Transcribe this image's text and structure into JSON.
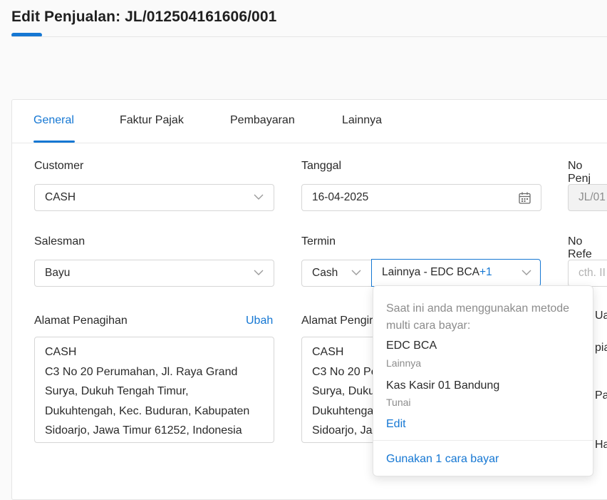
{
  "page": {
    "title": "Edit Penjualan: JL/012504161606/001"
  },
  "tabs": [
    {
      "label": "General",
      "active": true
    },
    {
      "label": "Faktur Pajak"
    },
    {
      "label": "Pembayaran"
    },
    {
      "label": "Lainnya"
    }
  ],
  "form": {
    "customer": {
      "label": "Customer",
      "value": "CASH"
    },
    "tanggal": {
      "label": "Tanggal",
      "value": "16-04-2025"
    },
    "no_penjualan": {
      "label": "No Penj",
      "value": "JL/01"
    },
    "salesman": {
      "label": "Salesman",
      "value": "Bayu"
    },
    "termin": {
      "label": "Termin",
      "value": "Cash"
    },
    "payment": {
      "value": "Lainnya - EDC BCA",
      "extra": "+1"
    },
    "no_referensi": {
      "label": "No Refe",
      "placeholder": "cth. II"
    },
    "alamat_penagihan": {
      "label": "Alamat Penagihan",
      "action": "Ubah",
      "lines": [
        "CASH",
        "C3 No 20 Perumahan, Jl. Raya Grand",
        "Surya, Dukuh Tengah Timur,",
        "Dukuhtengah, Kec. Buduran, Kabupaten",
        "Sidoarjo, Jawa Timur 61252, Indonesia"
      ]
    },
    "alamat_pengiriman": {
      "label": "Alamat Pengir",
      "lines": [
        "CASH",
        "C3 No 20 Pe",
        "Surya, Duku",
        "Dukuhtenga",
        "Sidoarjo, Ja"
      ]
    },
    "right_edge_labels": [
      "Ua",
      "pia",
      "Paja",
      "Har"
    ]
  },
  "payment_dropdown": {
    "intro": "Saat ini anda menggunakan metode multi cara bayar:",
    "methods": [
      {
        "name": "EDC BCA",
        "type": "Lainnya"
      },
      {
        "name": "Kas Kasir 01 Bandung",
        "type": "Tunai"
      }
    ],
    "edit_label": "Edit",
    "single_label": "Gunakan 1 cara bayar"
  },
  "colors": {
    "accent": "#1577d3",
    "border": "#d6d6d6",
    "muted_text": "#8c8c8c"
  },
  "icons": {
    "dropdown": "chevron-down-icon",
    "date": "calendar-icon"
  }
}
